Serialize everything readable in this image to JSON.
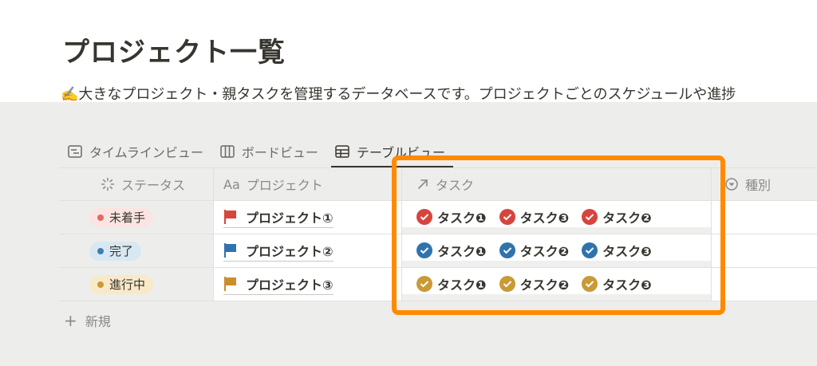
{
  "page": {
    "title": "プロジェクト一覧",
    "description": "✍️大きなプロジェクト・親タスクを管理するデータベースです。プロジェクトごとのスケジュールや進捗"
  },
  "views": [
    {
      "label": "タイムラインビュー",
      "icon": "timeline-icon",
      "active": false
    },
    {
      "label": "ボードビュー",
      "icon": "board-icon",
      "active": false
    },
    {
      "label": "テーブルビュー",
      "icon": "table-icon",
      "active": true
    }
  ],
  "columns": {
    "status": "ステータス",
    "project_prefix": "Aa",
    "project": "プロジェクト",
    "task": "タスク",
    "kind": "種別"
  },
  "rows": [
    {
      "status": "未着手",
      "status_bg": "#fbe4e1",
      "status_dot": "#e06b5e",
      "project": "プロジェクト①",
      "flag_color": "#d8453a",
      "check_color": "#d6453d",
      "tasks": [
        "タスク❶",
        "タスク❸",
        "タスク❷"
      ]
    },
    {
      "status": "完了",
      "status_bg": "#d8e8f3",
      "status_dot": "#3a7fb5",
      "project": "プロジェクト②",
      "flag_color": "#2f73ad",
      "check_color": "#2f73ad",
      "tasks": [
        "タスク❶",
        "タスク❷",
        "タスク❸"
      ]
    },
    {
      "status": "進行中",
      "status_bg": "#f8e9c9",
      "status_dot": "#c99a35",
      "project": "プロジェクト③",
      "flag_color": "#c98f2f",
      "check_color": "#c99a35",
      "tasks": [
        "タスク❶",
        "タスク❷",
        "タスク❸"
      ]
    }
  ],
  "new_label": "新規",
  "highlight_color": "#ff8a00"
}
